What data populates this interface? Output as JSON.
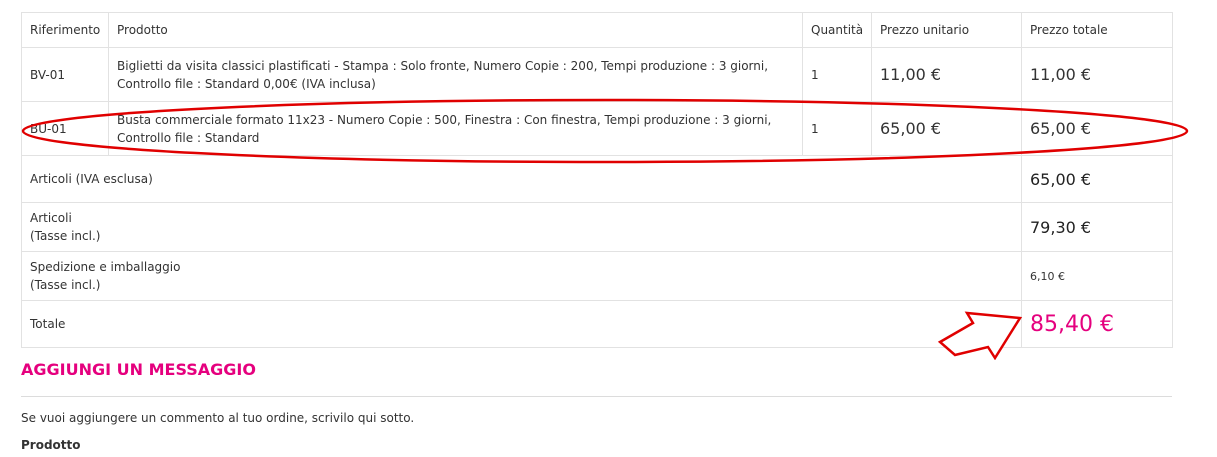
{
  "table": {
    "headers": {
      "reference": "Riferimento",
      "product": "Prodotto",
      "quantity": "Quantità",
      "unit_price": "Prezzo unitario",
      "total_price": "Prezzo totale"
    },
    "items": [
      {
        "reference": "BV-01",
        "description": "Biglietti da visita classici plastificati - Stampa : Solo fronte, Numero Copie : 200, Tempi produzione : 3 giorni, Controllo file : Standard 0,00€ (IVA inclusa)",
        "quantity": "1",
        "unit_price": "11,00 €",
        "total_price": "11,00 €"
      },
      {
        "reference": "BU-01",
        "description": "Busta commerciale formato 11x23 - Numero Copie : 500, Finestra : Con finestra, Tempi produzione : 3 giorni, Controllo file : Standard",
        "quantity": "1",
        "unit_price": "65,00 €",
        "total_price": "65,00 €"
      }
    ],
    "summary": {
      "items_excl_label": "Articoli (IVA esclusa)",
      "items_excl_value": "65,00 €",
      "items_incl_label_1": "Articoli",
      "items_incl_label_2": "(Tasse incl.)",
      "items_incl_value": "79,30 €",
      "shipping_label_1": "Spedizione e imballaggio",
      "shipping_label_2": "(Tasse incl.)",
      "shipping_value": "6,10 €",
      "total_label": "Totale",
      "total_value": "85,40 €"
    }
  },
  "message": {
    "title": "AGGIUNGI UN MESSAGGIO",
    "hint": "Se vuoi aggiungere un commento al tuo ordine, scrivilo qui sotto.",
    "product_label": "Prodotto"
  },
  "colors": {
    "accent": "#e5007e",
    "annotation": "#e00000",
    "border": "#e2e2e2"
  },
  "icons": {
    "highlight": "red-ellipse-annotation",
    "pointer": "red-arrow-annotation"
  }
}
